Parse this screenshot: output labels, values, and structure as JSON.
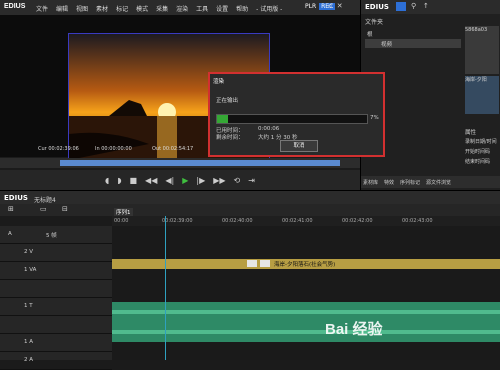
{
  "app": {
    "logo": "EDIUS",
    "menu": [
      "文件",
      "编辑",
      "视图",
      "素材",
      "标记",
      "模式",
      "采集",
      "渲染",
      "工具",
      "设置",
      "帮助",
      "- 试用版 -"
    ],
    "plr": "PLR",
    "rec": "REC"
  },
  "player": {
    "cur_label": "Cur",
    "cur_tc": "00:02:39:06",
    "in_label": "In",
    "in_tc": "00:00:00:00",
    "out_label": "Out",
    "out_tc": "00:02:54:17"
  },
  "render_dialog": {
    "title": "渲染",
    "status": "正在输出",
    "progress_percent": 7,
    "percent_text": "7%",
    "elapsed_label": "已用时间：",
    "elapsed_value": "0:00:06",
    "remaining_label": "剩余时间：",
    "remaining_value": "大约 1 分 30 秒",
    "cancel_label": "取消"
  },
  "right_panel": {
    "logo": "EDIUS",
    "folder_label": "文件夹",
    "root": "根",
    "video_folder": "视频",
    "clip_name": "5868a03",
    "clip2_name": "海岸-夕阳",
    "props_label": "属性",
    "props": [
      "录制日期/时间",
      "开始时间码",
      "结束时间码"
    ],
    "tabs": [
      "素材库",
      "特效",
      "序列标记",
      "源文件浏览"
    ]
  },
  "timeline": {
    "logo": "EDIUS",
    "sequence_title": "无标题4",
    "seq_tab": "序列1",
    "timecodes": [
      "00:00",
      "00:02:39:00",
      "00:02:40:00",
      "00:02:41:00",
      "00:02:42:00",
      "00:02:43:00"
    ],
    "tracks": [
      {
        "name": "A",
        "note": ""
      },
      {
        "name": "2 V",
        "note": ""
      },
      {
        "name": "1 VA",
        "note": ""
      },
      {
        "name": "",
        "note": ""
      },
      {
        "name": "1 T",
        "note": ""
      },
      {
        "name": "",
        "note": ""
      },
      {
        "name": "1 A",
        "note": ""
      },
      {
        "name": "2 A",
        "note": ""
      }
    ],
    "v_label": "5 帧",
    "clip_label": "海岸-夕阳落石(社会气势)"
  },
  "watermark": "Bai 经验"
}
